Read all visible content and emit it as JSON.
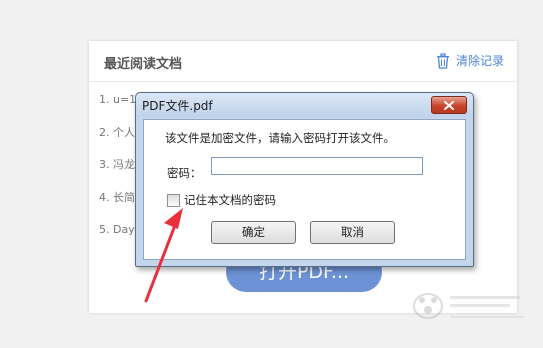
{
  "recent_panel": {
    "title": "最近阅读文档",
    "clear_label": "清除记录",
    "items": [
      {
        "label": "1. u=1"
      },
      {
        "label": "2. 个人"
      },
      {
        "label": "3. 冯龙"
      },
      {
        "label": "4. 长简"
      },
      {
        "label": "5. Day"
      }
    ],
    "open_button_label": "打开PDF..."
  },
  "dialog": {
    "title": "PDF文件.pdf",
    "message": "该文件是加密文件，请输入密码打开该文件。",
    "password_label": "密码：",
    "password_value": "",
    "remember_label": "记住本文档的密码",
    "remember_checked": false,
    "ok_label": "确定",
    "cancel_label": "取消"
  },
  "colors": {
    "accent": "#4a86d8",
    "open_button": "#6d93d6",
    "annotation_arrow": "#e8303c",
    "close_button": "#c9442c"
  },
  "icons": {
    "clear": "trash-icon",
    "close": "close-icon"
  }
}
